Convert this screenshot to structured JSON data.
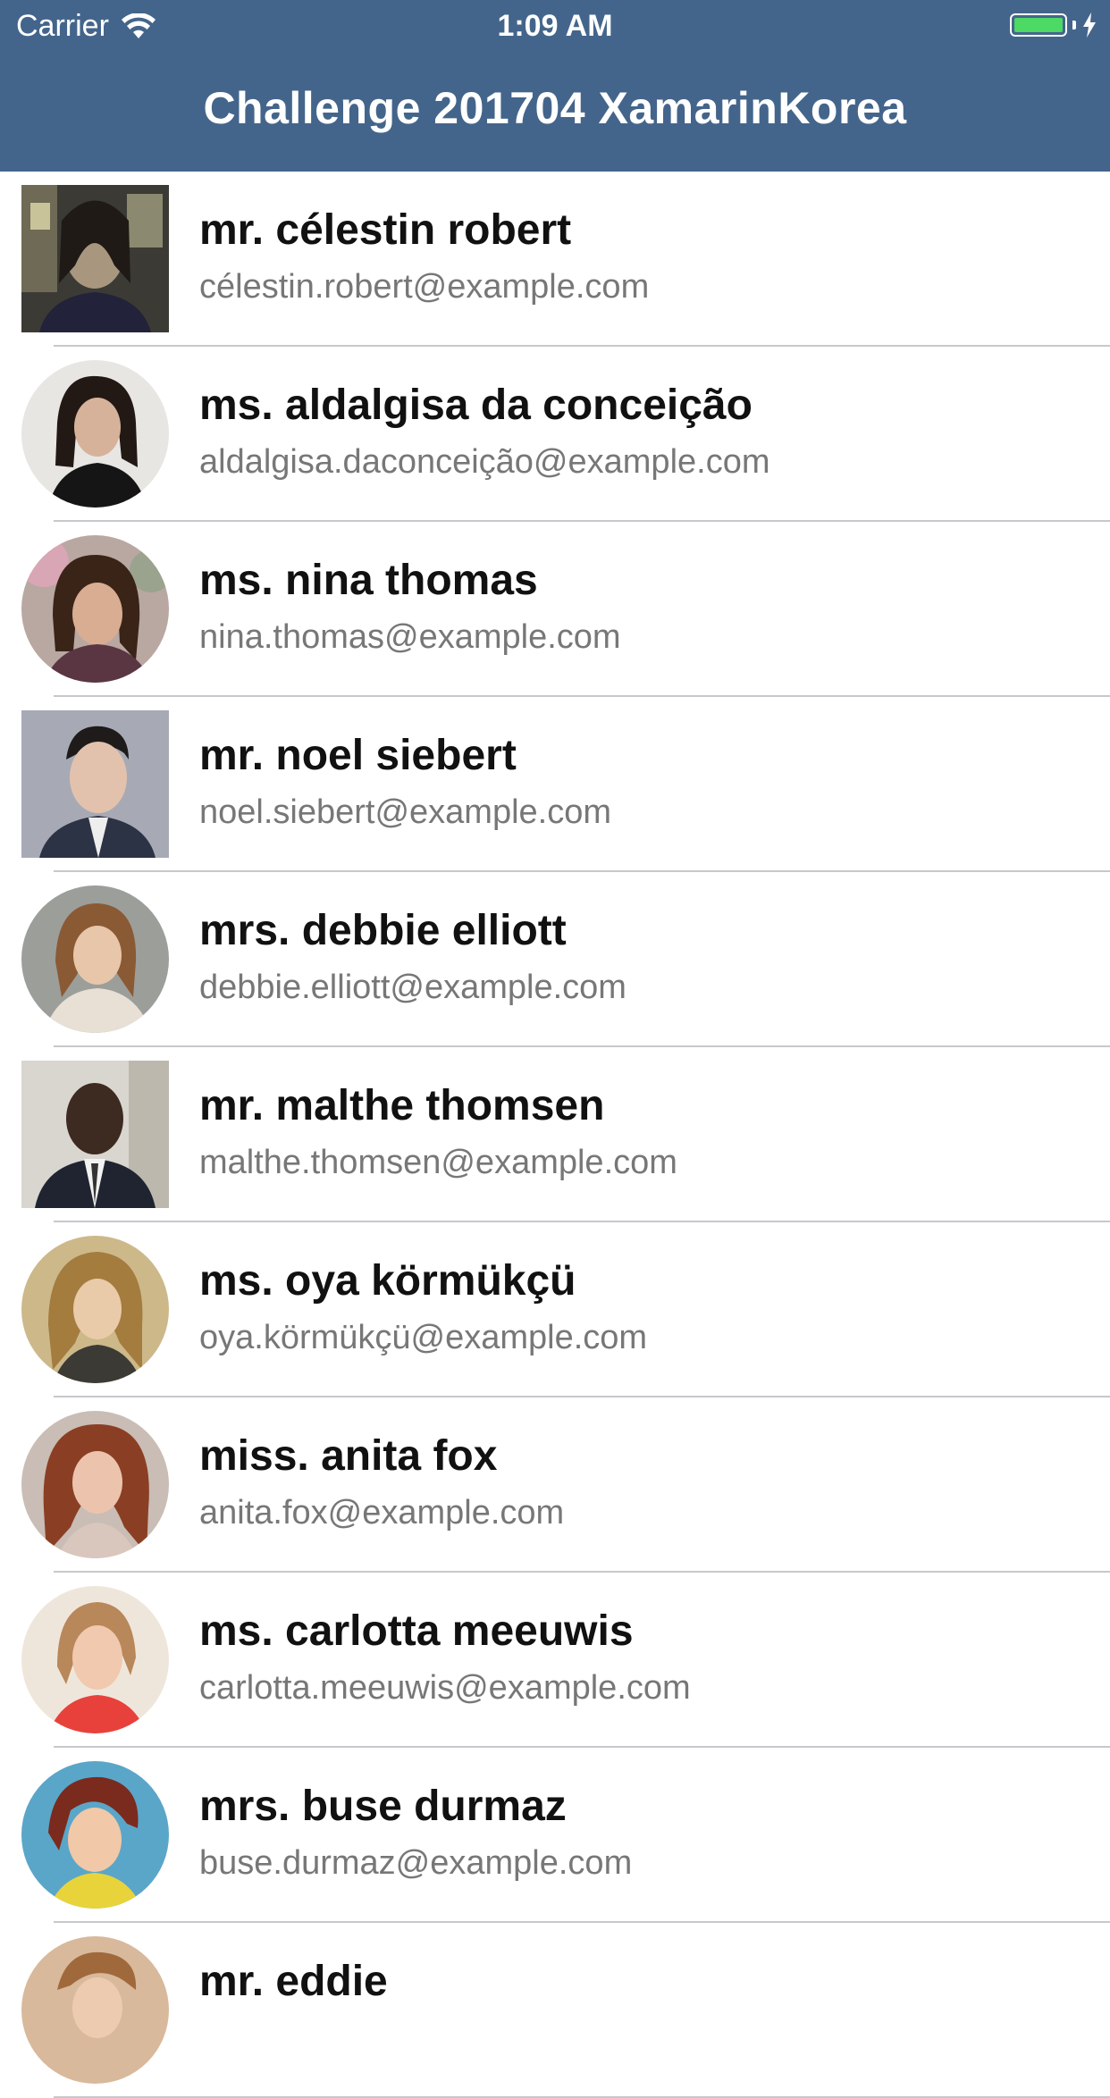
{
  "status_bar": {
    "carrier": "Carrier",
    "time": "1:09 AM",
    "wifi_icon": "wifi-icon",
    "battery_icon": "battery-icon",
    "charging_icon": "bolt-icon",
    "battery_color": "#4cd964"
  },
  "nav": {
    "title": "Challenge 201704 XamarinKorea",
    "background": "#44658b"
  },
  "contacts": [
    {
      "name": "mr. célestin robert",
      "email": "célestin.robert@example.com"
    },
    {
      "name": "ms. aldalgisa da conceição",
      "email": "aldalgisa.daconceição@example.com"
    },
    {
      "name": "ms. nina thomas",
      "email": "nina.thomas@example.com"
    },
    {
      "name": "mr. noel siebert",
      "email": "noel.siebert@example.com"
    },
    {
      "name": "mrs. debbie elliott",
      "email": "debbie.elliott@example.com"
    },
    {
      "name": "mr. malthe thomsen",
      "email": "malthe.thomsen@example.com"
    },
    {
      "name": "ms. oya körmükçü",
      "email": "oya.körmükçü@example.com"
    },
    {
      "name": "miss. anita fox",
      "email": "anita.fox@example.com"
    },
    {
      "name": "ms. carlotta meeuwis",
      "email": "carlotta.meeuwis@example.com"
    },
    {
      "name": "mrs. buse durmaz",
      "email": "buse.durmaz@example.com"
    },
    {
      "name": "mr. eddie",
      "email": ""
    }
  ]
}
